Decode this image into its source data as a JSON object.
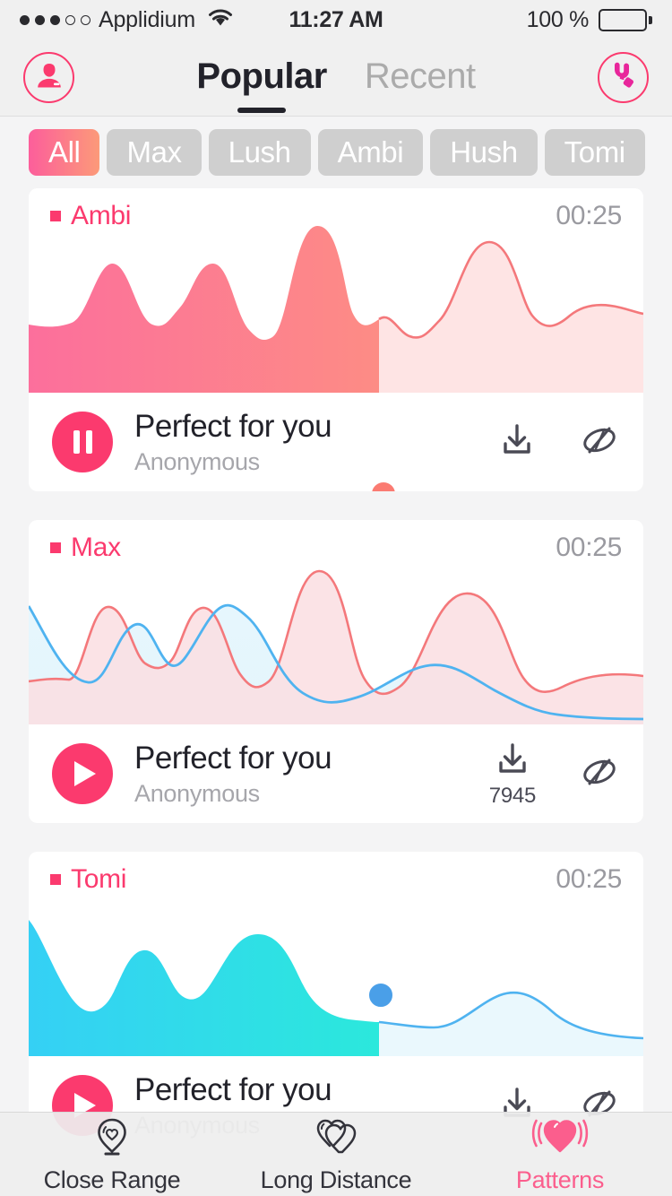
{
  "status_bar": {
    "signal_dots_filled": 3,
    "signal_dots_total": 5,
    "carrier": "Applidium",
    "wifi_icon": "wifi-icon",
    "time": "11:27 AM",
    "battery_percent": "100 %",
    "battery_icon": "battery-full-icon"
  },
  "nav": {
    "profile_icon": "profile-avatar-icon",
    "device_icon": "toy-device-icon",
    "tabs": [
      {
        "label": "Popular",
        "active": true
      },
      {
        "label": "Recent",
        "active": false
      }
    ]
  },
  "filters": {
    "chips": [
      {
        "label": "All",
        "active": true
      },
      {
        "label": "Max",
        "active": false
      },
      {
        "label": "Lush",
        "active": false
      },
      {
        "label": "Ambi",
        "active": false
      },
      {
        "label": "Hush",
        "active": false
      },
      {
        "label": "Tomi",
        "active": false
      }
    ]
  },
  "colors": {
    "accent_pink": "#FB3A6E",
    "chip_gradient_start": "#FC5E9B",
    "chip_gradient_end": "#FC9A79",
    "wave_pink_start": "#FC7196",
    "wave_salmon_end": "#FD8C85",
    "wave_pink_track": "#FEE4E4",
    "wave_cyan_start": "#35D0F5",
    "wave_cyan_end": "#2BE8DC",
    "wave_cyan_track": "#EAF8FD",
    "wave_blue_line": "#4FB3F0",
    "wave_red_line": "#F4787B",
    "icon_slate": "#4A4A55",
    "muted_text": "#A6A6AB",
    "page_background": "#F4F4F5"
  },
  "cards": [
    {
      "brand": "Ambi",
      "duration": "00:25",
      "title": "Perfect for you",
      "author": "Anonymous",
      "playing": true,
      "play_button_icon": "pause-icon",
      "download_icon": "download-icon",
      "download_count": "",
      "visibility_icon": "eye-slash-icon",
      "progress_percent": 57,
      "wave_style": "pink-gradient-single"
    },
    {
      "brand": "Max",
      "duration": "00:25",
      "title": "Perfect for you",
      "author": "Anonymous",
      "playing": false,
      "play_button_icon": "play-icon",
      "download_icon": "download-icon",
      "download_count": "7945",
      "visibility_icon": "eye-slash-icon",
      "progress_percent": 0,
      "wave_style": "dual-red-blue"
    },
    {
      "brand": "Tomi",
      "duration": "00:25",
      "title": "Perfect for you",
      "author": "Anonymous",
      "playing": false,
      "play_button_icon": "play-icon",
      "download_icon": "download-icon",
      "download_count": "",
      "visibility_icon": "eye-slash-icon",
      "progress_percent": 57,
      "wave_style": "cyan-gradient-single"
    }
  ],
  "tabbar": {
    "items": [
      {
        "label": "Close Range",
        "icon": "pin-heart-icon",
        "active": false
      },
      {
        "label": "Long Distance",
        "icon": "two-hearts-icon",
        "active": false
      },
      {
        "label": "Patterns",
        "icon": "pulsing-heart-icon",
        "active": true
      }
    ]
  }
}
